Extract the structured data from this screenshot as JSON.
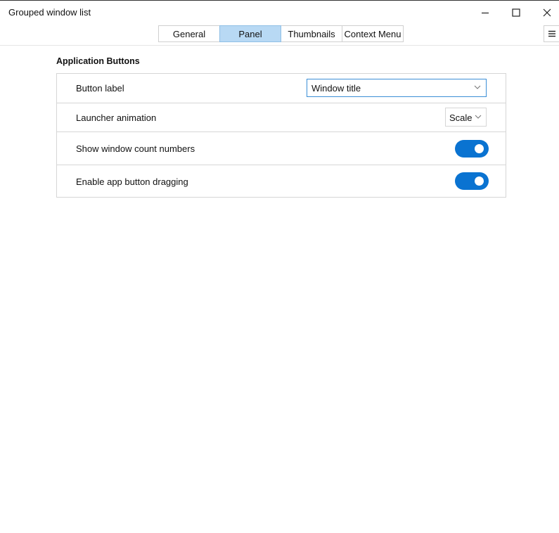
{
  "window": {
    "title": "Grouped window list",
    "controls": {
      "minimize_icon": "minimize-icon",
      "maximize_icon": "maximize-icon",
      "close_icon": "close-icon"
    }
  },
  "tabs": [
    {
      "label": "General",
      "active": false
    },
    {
      "label": "Panel",
      "active": true
    },
    {
      "label": "Thumbnails",
      "active": false
    },
    {
      "label": "Context Menu",
      "active": false
    }
  ],
  "menu_icon": "hamburger-menu-icon",
  "section": {
    "title": "Application Buttons",
    "rows": {
      "button_label": {
        "label": "Button label",
        "value": "Window title"
      },
      "launcher_animation": {
        "label": "Launcher animation",
        "value": "Scale"
      },
      "show_window_count": {
        "label": "Show window count numbers",
        "enabled": true
      },
      "enable_dragging": {
        "label": "Enable app button dragging",
        "enabled": true
      }
    }
  },
  "colors": {
    "accent": "#0a73d1",
    "active_tab": "#b8d9f4",
    "focus_border": "#3b8ed6"
  }
}
